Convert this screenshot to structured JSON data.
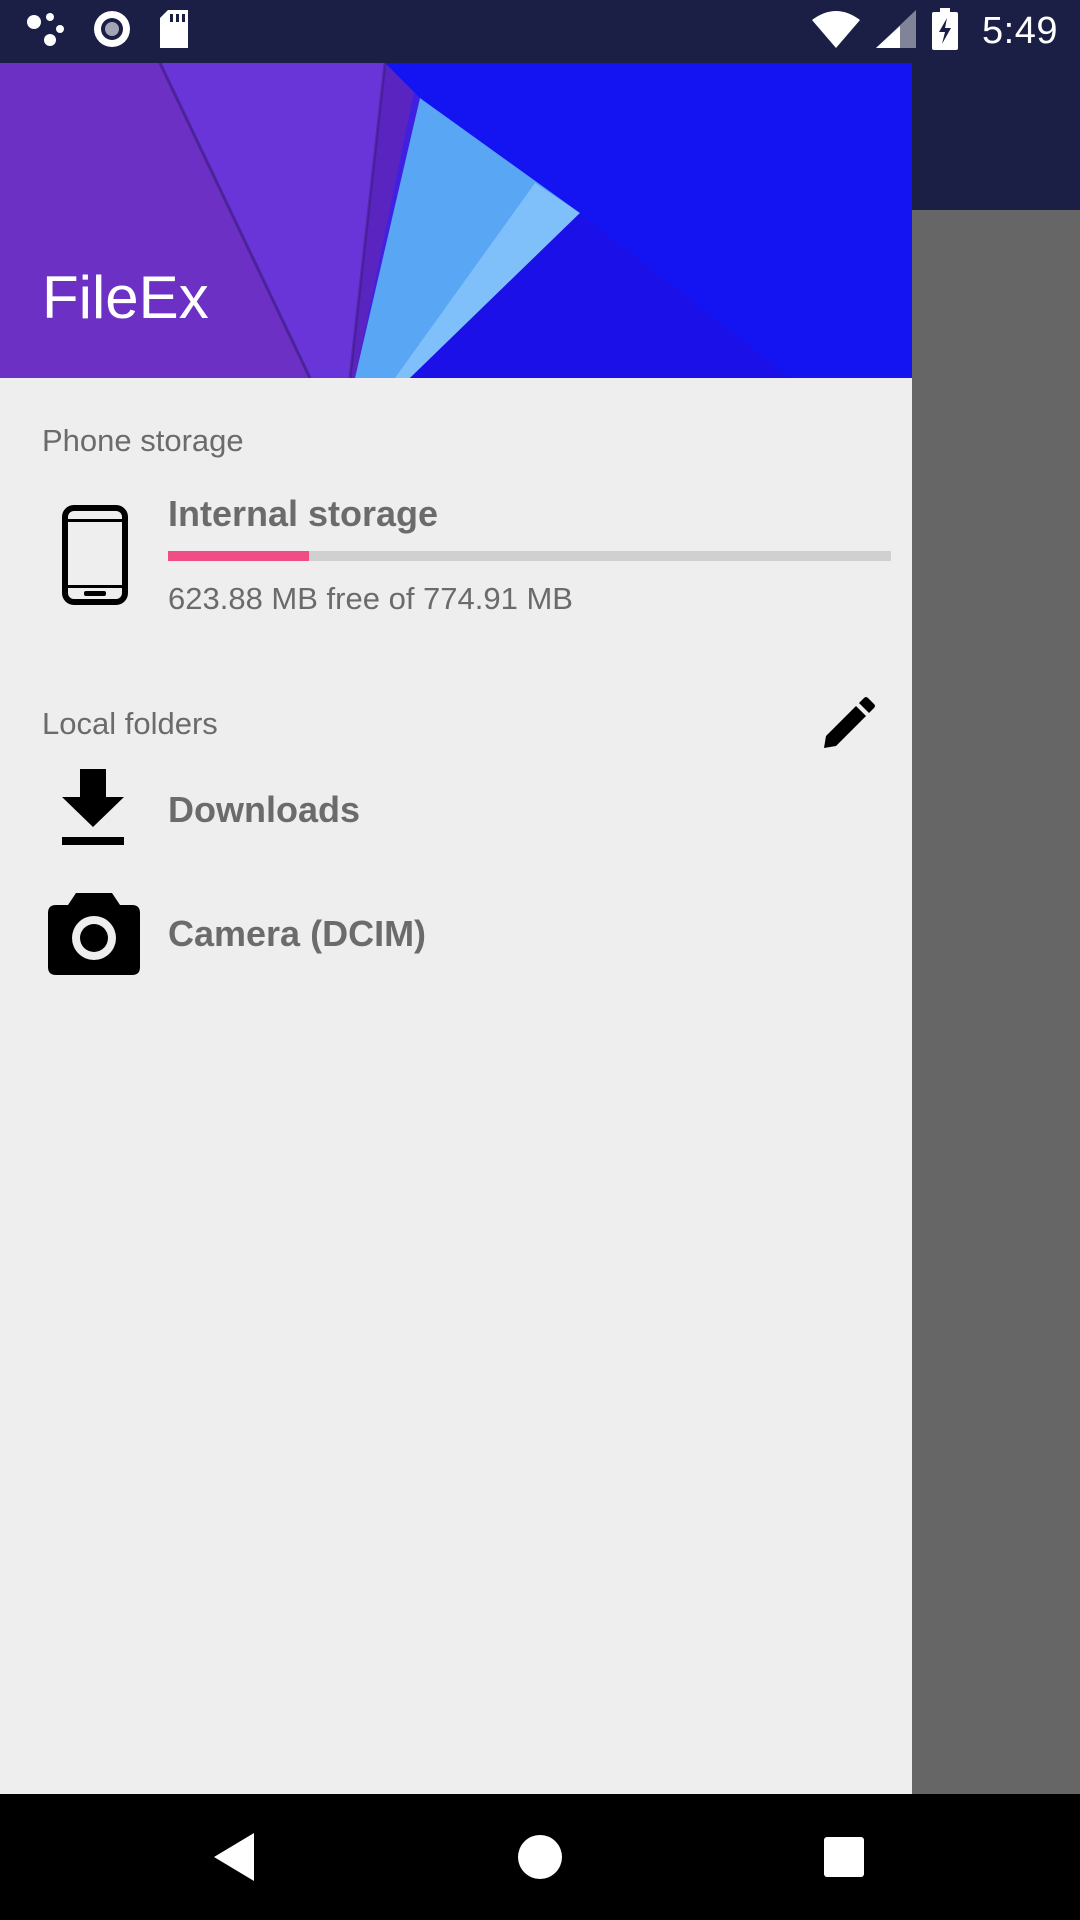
{
  "status_bar": {
    "time": "5:49",
    "left_icons": [
      "notification-dots-icon",
      "record-icon",
      "sd-card-icon"
    ],
    "right_icons": [
      "wifi-icon",
      "cell-signal-icon",
      "battery-charging-icon"
    ]
  },
  "drawer": {
    "app_title": "FileEx",
    "header_colors": {
      "primary": "#6a2fc9",
      "accent": "#1414f2",
      "light": "#5aa8f5"
    },
    "phone_storage": {
      "section_label": "Phone storage",
      "item_title": "Internal storage",
      "free_text": "623.88 MB free of 774.91 MB",
      "used_fraction": 0.195,
      "bar_color": "#f04d86",
      "icon": "smartphone-icon"
    },
    "local_folders": {
      "section_label": "Local folders",
      "edit_icon": "pencil-icon",
      "items": [
        {
          "label": "Downloads",
          "icon": "download-icon"
        },
        {
          "label": "Camera (DCIM)",
          "icon": "camera-icon"
        }
      ]
    }
  },
  "nav_bar": {
    "buttons": [
      "back-icon",
      "home-icon",
      "recents-icon"
    ]
  }
}
